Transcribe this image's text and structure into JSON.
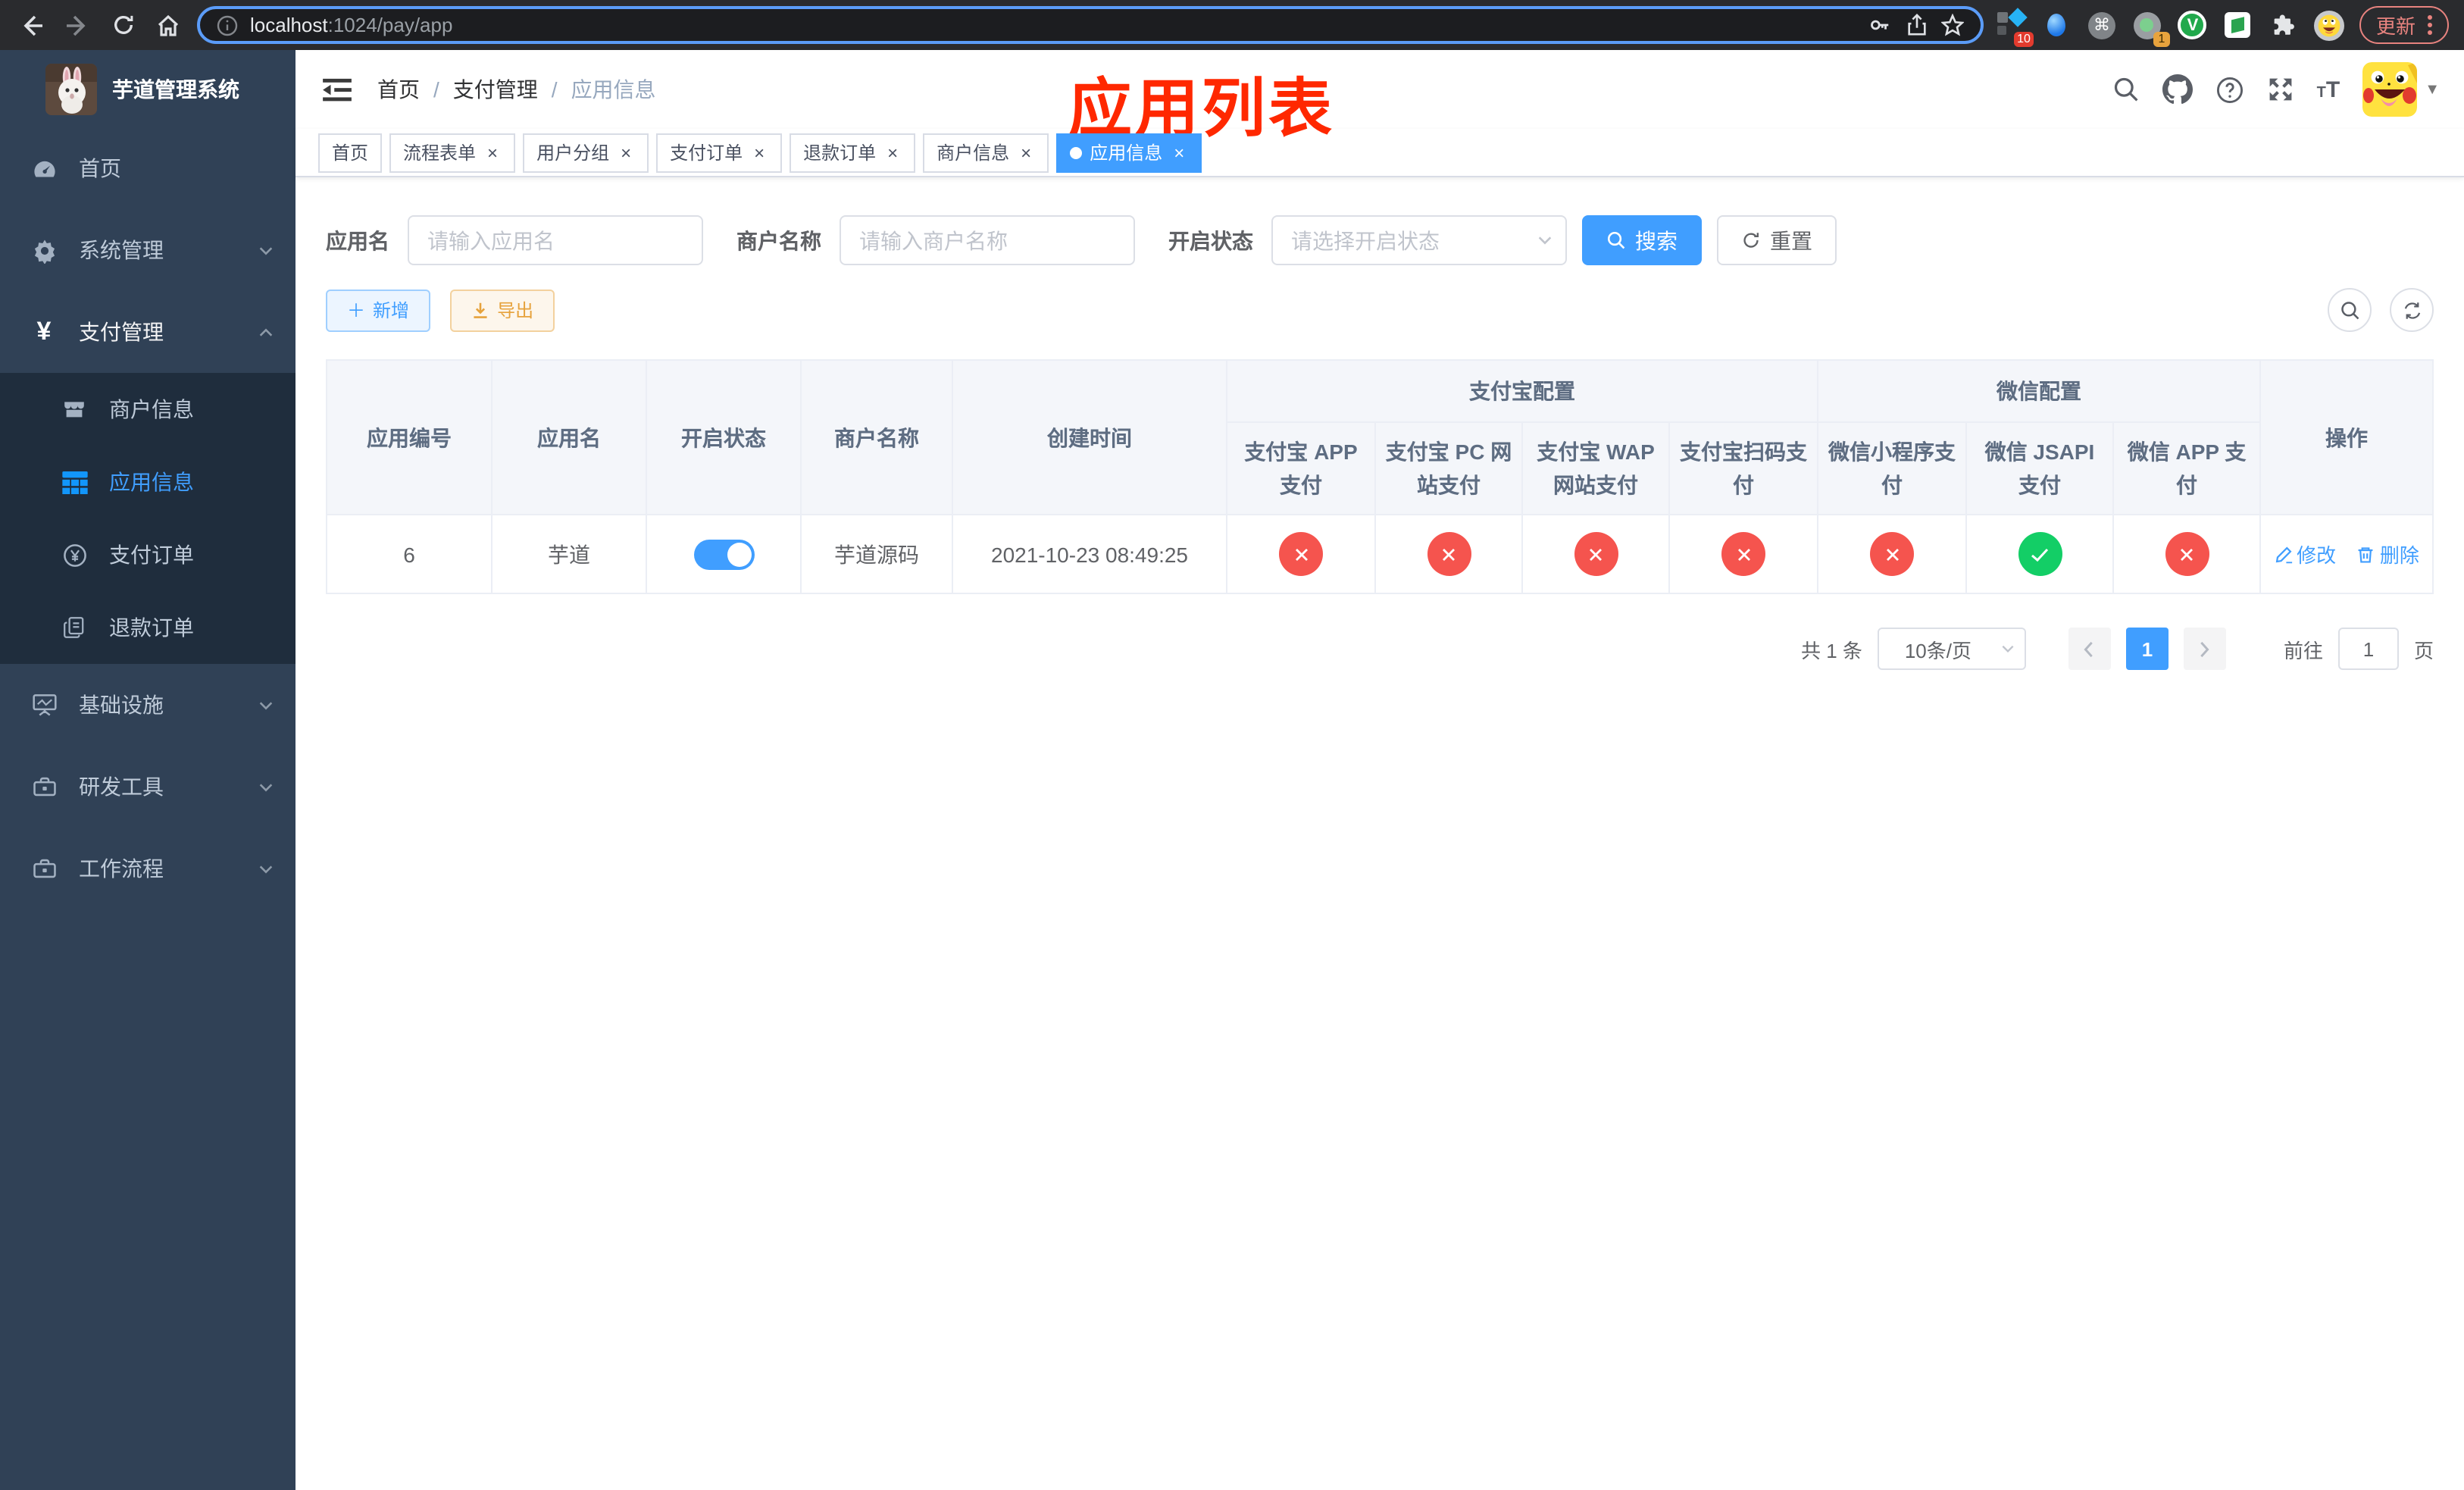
{
  "browser": {
    "url": {
      "host": "localhost",
      "path": ":1024/pay/app"
    },
    "update_button": "更新",
    "ext_badge_translate": "10",
    "ext_badge_recorder": "1",
    "ext_letter_v": "V"
  },
  "sidebar": {
    "title": "芋道管理系统",
    "items": [
      {
        "label": "首页"
      },
      {
        "label": "系统管理"
      },
      {
        "label": "支付管理"
      },
      {
        "label": "基础设施"
      },
      {
        "label": "研发工具"
      },
      {
        "label": "工作流程"
      }
    ],
    "payment_submenu": [
      {
        "label": "商户信息"
      },
      {
        "label": "应用信息"
      },
      {
        "label": "支付订单"
      },
      {
        "label": "退款订单"
      }
    ]
  },
  "navbar": {
    "breadcrumb": [
      "首页",
      "支付管理",
      "应用信息"
    ]
  },
  "annotation": "应用列表",
  "tabs": [
    {
      "label": "首页",
      "closable": false,
      "active": false
    },
    {
      "label": "流程表单",
      "closable": true,
      "active": false
    },
    {
      "label": "用户分组",
      "closable": true,
      "active": false
    },
    {
      "label": "支付订单",
      "closable": true,
      "active": false
    },
    {
      "label": "退款订单",
      "closable": true,
      "active": false
    },
    {
      "label": "商户信息",
      "closable": true,
      "active": false
    },
    {
      "label": "应用信息",
      "closable": true,
      "active": true
    }
  ],
  "filters": {
    "app_name_label": "应用名",
    "app_name_placeholder": "请输入应用名",
    "merchant_label": "商户名称",
    "merchant_placeholder": "请输入商户名称",
    "status_label": "开启状态",
    "status_placeholder": "请选择开启状态",
    "search_label": "搜索",
    "reset_label": "重置"
  },
  "toolbar": {
    "add_label": "新增",
    "export_label": "导出"
  },
  "table": {
    "headers": {
      "app_id": "应用编号",
      "app_name": "应用名",
      "status": "开启状态",
      "merchant": "商户名称",
      "created": "创建时间",
      "group_alipay": "支付宝配置",
      "group_wechat": "微信配置",
      "alipay_app": "支付宝 APP 支付",
      "alipay_pc": "支付宝 PC 网站支付",
      "alipay_wap": "支付宝 WAP 网站支付",
      "alipay_qr": "支付宝扫码支付",
      "wx_mini": "微信小程序支付",
      "wx_jsapi": "微信 JSAPI 支付",
      "wx_app": "微信 APP 支付",
      "actions": "操作"
    },
    "row": {
      "id": "6",
      "name": "芋道",
      "enabled": true,
      "merchant": "芋道源码",
      "created": "2021-10-23 08:49:25",
      "statuses": [
        false,
        false,
        false,
        false,
        false,
        true,
        false
      ],
      "edit_label": "修改",
      "delete_label": "删除"
    }
  },
  "pagination": {
    "total": "共 1 条",
    "page_size": "10条/页",
    "page": "1",
    "goto_label": "前往",
    "goto_value": "1",
    "page_suffix": "页"
  },
  "colors": {
    "primary": "#409eff",
    "sidebar_bg": "#304156",
    "submenu_bg": "#1f2d3d",
    "success": "#13ce66",
    "danger": "#f5544e",
    "warning": "#e6a23c",
    "annotation_red": "#ff2800"
  }
}
